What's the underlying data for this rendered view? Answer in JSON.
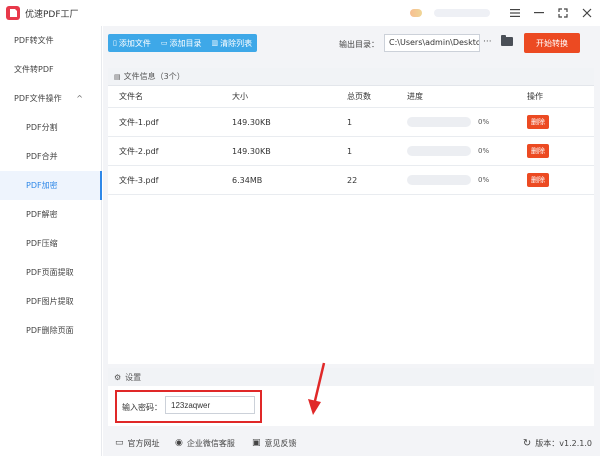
{
  "app": {
    "title": "优速PDF工厂",
    "accent": "#3ea8e8",
    "danger": "#ec4a22"
  },
  "window_controls": [
    "menu-icon",
    "minimize-icon",
    "maximize-icon",
    "close-icon"
  ],
  "sidebar": {
    "items": [
      {
        "label": "PDF转文件",
        "level": 0,
        "active": false
      },
      {
        "label": "文件转PDF",
        "level": 0,
        "active": false
      },
      {
        "label": "PDF文件操作",
        "level": 0,
        "active": false,
        "expanded": true
      },
      {
        "label": "PDF分割",
        "level": 1,
        "active": false
      },
      {
        "label": "PDF合并",
        "level": 1,
        "active": false
      },
      {
        "label": "PDF加密",
        "level": 1,
        "active": true
      },
      {
        "label": "PDF解密",
        "level": 1,
        "active": false
      },
      {
        "label": "PDF压缩",
        "level": 1,
        "active": false
      },
      {
        "label": "PDF页面提取",
        "level": 1,
        "active": false
      },
      {
        "label": "PDF图片提取",
        "level": 1,
        "active": false
      },
      {
        "label": "PDF删除页面",
        "level": 1,
        "active": false
      }
    ]
  },
  "toolbar": {
    "add_file": "添加文件",
    "add_folder": "添加目录",
    "clear_list": "清除列表",
    "output_label": "输出目录：",
    "output_path": "C:\\Users\\admin\\Deskto",
    "more": "···",
    "start": "开始转换"
  },
  "file_panel": {
    "title": "文件信息（3个）",
    "columns": {
      "name": "文件名",
      "size": "大小",
      "pages": "总页数",
      "progress": "进度",
      "action": "操作"
    },
    "rows": [
      {
        "name": "文件-1.pdf",
        "size": "149.30KB",
        "pages": "1",
        "progress": "0%",
        "progress_value": 0,
        "action": "删除"
      },
      {
        "name": "文件-2.pdf",
        "size": "149.30KB",
        "pages": "1",
        "progress": "0%",
        "progress_value": 0,
        "action": "删除"
      },
      {
        "name": "文件-3.pdf",
        "size": "6.34MB",
        "pages": "22",
        "progress": "0%",
        "progress_value": 0,
        "action": "删除"
      }
    ]
  },
  "settings": {
    "title": "设置",
    "password_label": "输入密码：",
    "password_value": "123zaqwer"
  },
  "footer": {
    "website": "官方网址",
    "wechat": "企业微信客服",
    "feedback": "意见反馈",
    "version": "版本：v1.2.1.0"
  }
}
